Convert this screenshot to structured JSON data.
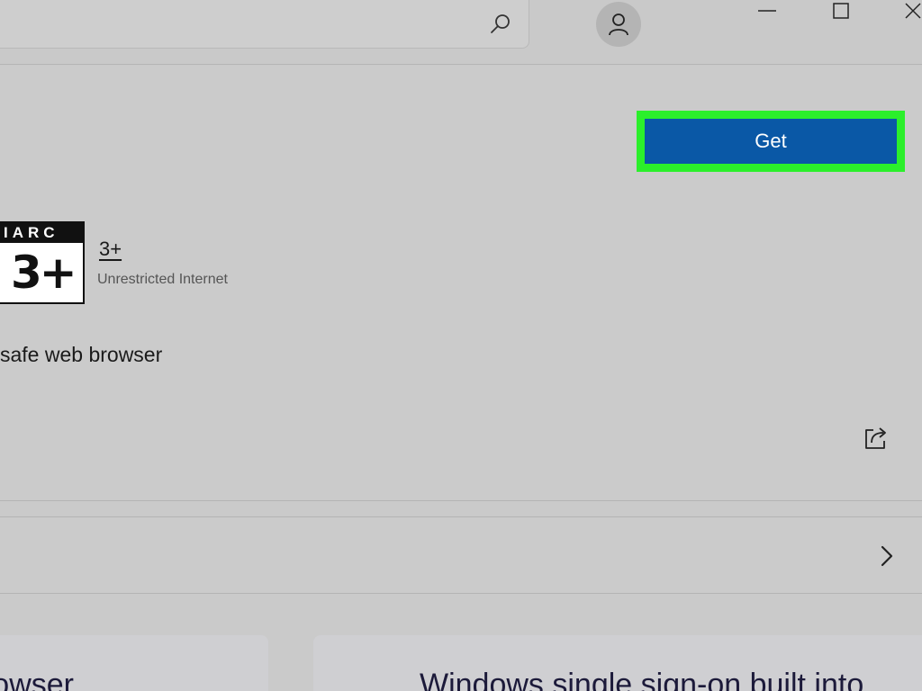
{
  "titlebar": {
    "search_placeholder": "",
    "icons": {
      "search": "search-icon",
      "account": "account-icon",
      "minimize": "minimize-icon",
      "maximize": "maximize-icon",
      "close": "close-icon"
    }
  },
  "hero": {
    "get_label": "Get",
    "rating": {
      "board": "IARC",
      "badge": "3+",
      "value": "3+",
      "description": "Unrestricted Internet"
    },
    "tagline": "safe web browser",
    "share_icon": "share-icon"
  },
  "expand_row": {
    "chevron_icon": "chevron-right-icon"
  },
  "cards": [
    {
      "title": "owser"
    },
    {
      "title": "Windows single sign-on built into"
    }
  ],
  "colors": {
    "background": "#cacaca",
    "get_button": "#0a58a6",
    "highlight": "#2bef2b",
    "card_text": "#1c1a3a"
  }
}
